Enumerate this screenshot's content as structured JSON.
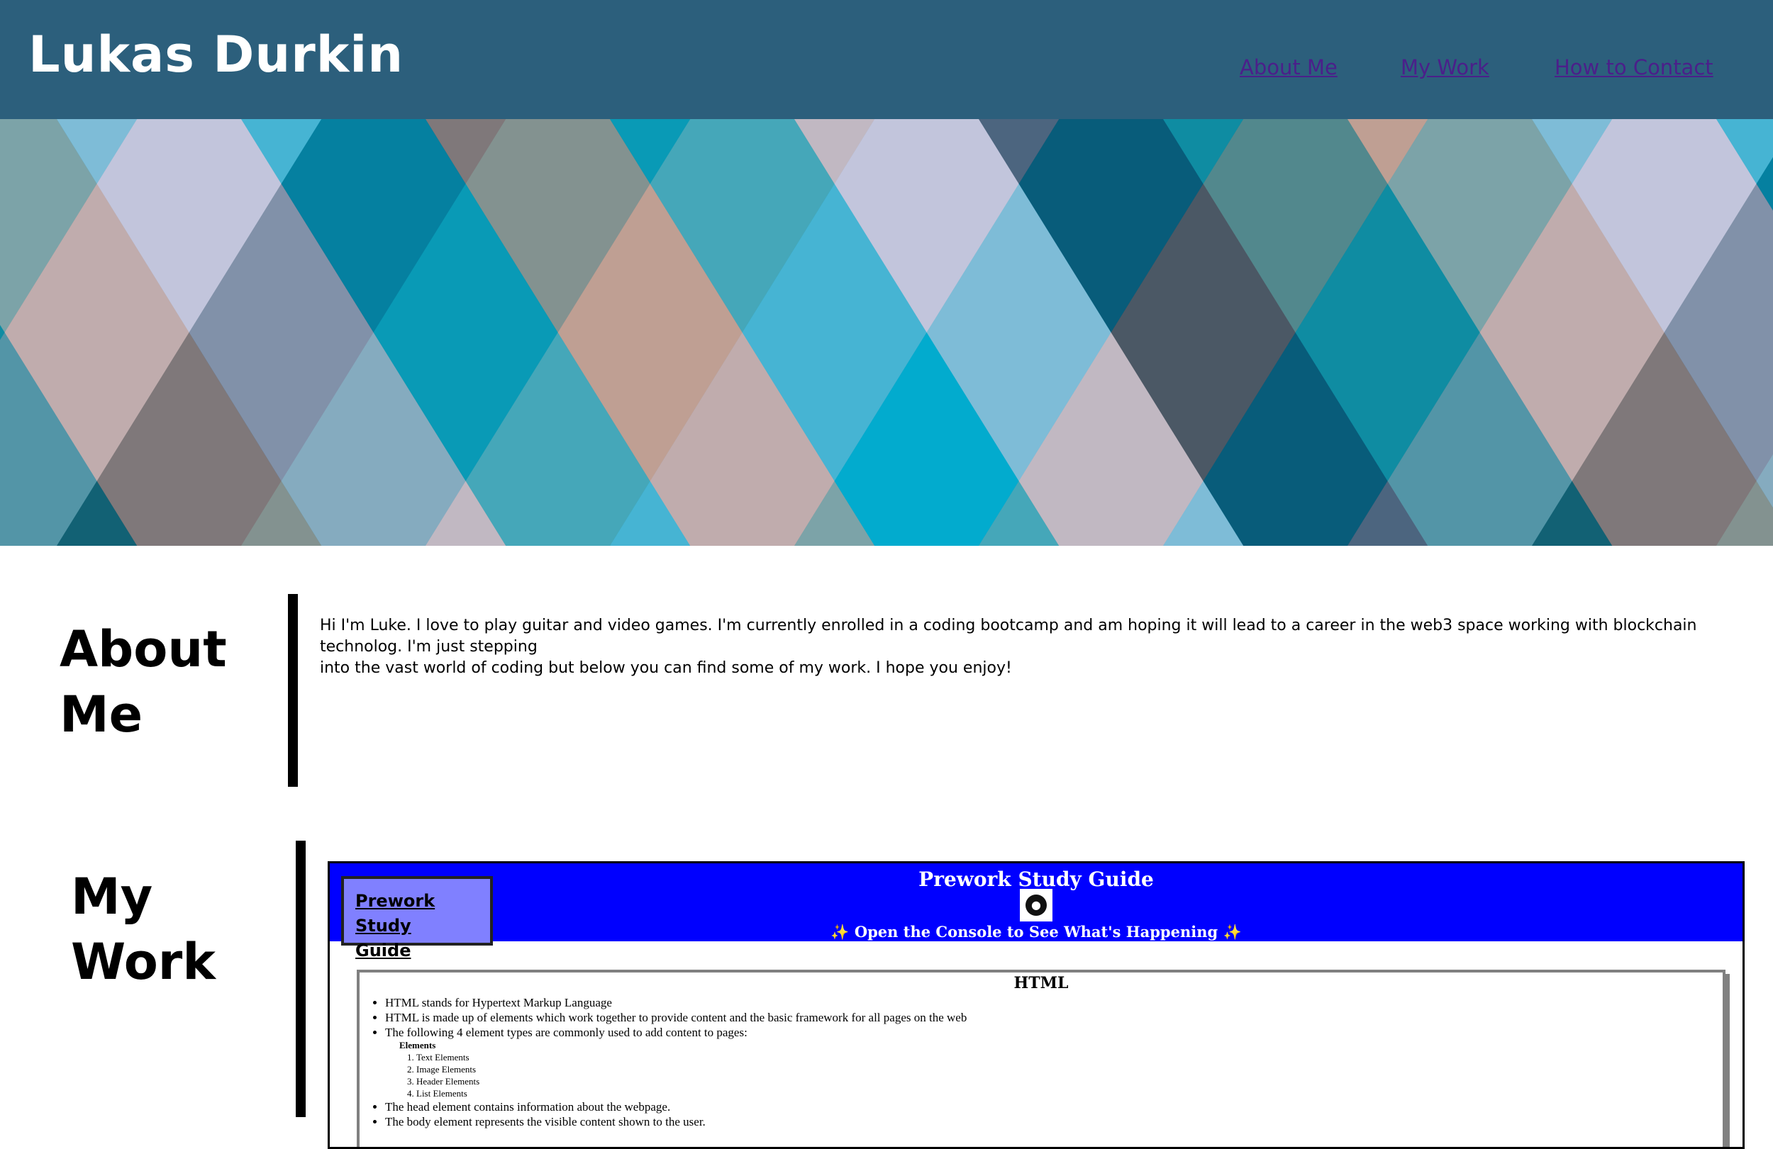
{
  "header": {
    "title": "Lukas Durkin",
    "nav": [
      "About Me",
      "My Work",
      "How to Contact"
    ]
  },
  "hero": {
    "colors": [
      "#0b4a63",
      "#00c8ee",
      "#f4b8a2",
      "#f7e9ff",
      "#0b2a45",
      "#1a8a95"
    ]
  },
  "about": {
    "heading_line1": "About",
    "heading_line2": "Me",
    "text_line1": "Hi I'm Luke. I love to play guitar and video games. I'm currently enrolled in a coding bootcamp and am hoping it will lead to a career in the web3 space working with blockchain technolog. I'm just stepping",
    "text_line2": "into the vast world of coding but below you can find some of my work. I hope you enjoy!"
  },
  "work": {
    "heading_line1": "My",
    "heading_line2": "Work",
    "project": {
      "link_line1": "Prework Study",
      "link_line2": "Guide",
      "title": "Prework Study Guide",
      "icon": "robot-icon",
      "subtitle": "Open the Console to See What's Happening",
      "section_title": "HTML",
      "bullets_before": [
        "HTML stands for Hypertext Markup Language",
        "HTML is made up of elements which work together to provide content and the basic framework for all pages on the web",
        "The following 4 element types are commonly used to add content to pages:"
      ],
      "elements_title": "Elements",
      "elements": [
        "Text Elements",
        "Image Elements",
        "Header Elements",
        "List Elements"
      ],
      "bullets_after": [
        "The head element contains information about the webpage.",
        "The body element represents the visible content shown to the user."
      ]
    }
  }
}
